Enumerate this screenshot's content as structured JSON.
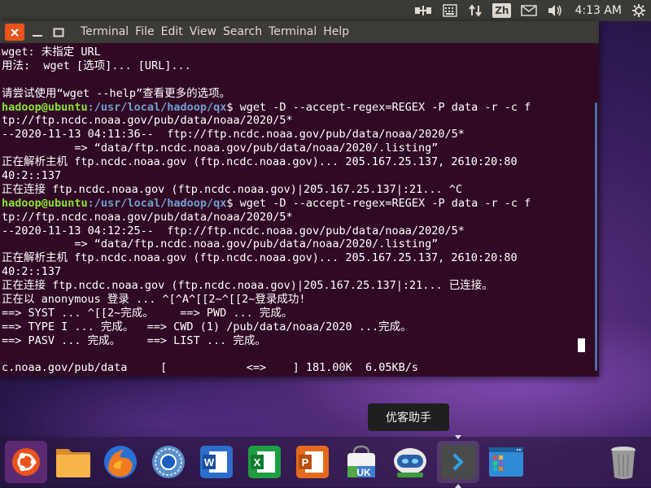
{
  "top_panel": {
    "language": "Zh",
    "clock": "4:13 AM",
    "tray_icons": [
      "network-icon",
      "keyboard-icon",
      "transfer-arrows-icon",
      "mail-icon",
      "volume-icon",
      "power-icon"
    ]
  },
  "window": {
    "menu": [
      "Terminal",
      "File",
      "Edit",
      "View",
      "Search",
      "Terminal",
      "Help"
    ]
  },
  "terminal": {
    "lines": [
      {
        "t": "wget: 未指定 URL"
      },
      {
        "t": "用法:  wget [选项]... [URL]..."
      },
      {
        "t": ""
      },
      {
        "t": "请尝试使用“wget --help”查看更多的选项。"
      },
      {
        "user": "hadoop@ubuntu",
        "path": ":/usr/local/hadoop/qx",
        "t": "$ wget -D --accept-regex=REGEX -P data -r -c f"
      },
      {
        "t": "tp://ftp.ncdc.noaa.gov/pub/data/noaa/2020/5*"
      },
      {
        "t": "--2020-11-13 04:11:36--  ftp://ftp.ncdc.noaa.gov/pub/data/noaa/2020/5*"
      },
      {
        "t": "           => “data/ftp.ncdc.noaa.gov/pub/data/noaa/2020/.listing”"
      },
      {
        "t": "正在解析主机 ftp.ncdc.noaa.gov (ftp.ncdc.noaa.gov)... 205.167.25.137, 2610:20:80"
      },
      {
        "t": "40:2::137"
      },
      {
        "t": "正在连接 ftp.ncdc.noaa.gov (ftp.ncdc.noaa.gov)|205.167.25.137|:21... ^C"
      },
      {
        "user": "hadoop@ubuntu",
        "path": ":/usr/local/hadoop/qx",
        "t": "$ wget -D --accept-regex=REGEX -P data -r -c f"
      },
      {
        "t": "tp://ftp.ncdc.noaa.gov/pub/data/noaa/2020/5*"
      },
      {
        "t": "--2020-11-13 04:12:25--  ftp://ftp.ncdc.noaa.gov/pub/data/noaa/2020/5*"
      },
      {
        "t": "           => “data/ftp.ncdc.noaa.gov/pub/data/noaa/2020/.listing”"
      },
      {
        "t": "正在解析主机 ftp.ncdc.noaa.gov (ftp.ncdc.noaa.gov)... 205.167.25.137, 2610:20:80"
      },
      {
        "t": "40:2::137"
      },
      {
        "t": "正在连接 ftp.ncdc.noaa.gov (ftp.ncdc.noaa.gov)|205.167.25.137|:21... 已连接。"
      },
      {
        "t": "正在以 anonymous 登录 ... ^[^A^[[2~^[[2~登录成功!"
      },
      {
        "t": "==> SYST ... ^[[2~完成。    ==> PWD ... 完成。"
      },
      {
        "t": "==> TYPE I ... 完成。  ==> CWD (1) /pub/data/noaa/2020 ...完成。"
      },
      {
        "t": "==> PASV ... 完成。    ==> LIST ... 完成。"
      },
      {
        "t": ""
      },
      {
        "t": "c.noaa.gov/pub/data     [            <=>    ] 181.00K  6.05KB/s"
      }
    ]
  },
  "tooltip": {
    "text": "优客助手"
  },
  "dock": {
    "items": [
      {
        "name": "ubuntu-dash-icon"
      },
      {
        "name": "files-folder-icon"
      },
      {
        "name": "firefox-icon"
      },
      {
        "name": "browser-globe-icon"
      },
      {
        "name": "wps-writer-icon",
        "label": "W"
      },
      {
        "name": "wps-spreadsheet-icon",
        "label": "X"
      },
      {
        "name": "wps-presentation-icon",
        "label": "P"
      },
      {
        "name": "ubuntu-kylin-software-icon",
        "label": "UK"
      },
      {
        "name": "youker-assistant-icon"
      },
      {
        "name": "terminal-icon"
      },
      {
        "name": "workspace-switcher-icon"
      },
      {
        "name": "trash-icon"
      }
    ]
  }
}
